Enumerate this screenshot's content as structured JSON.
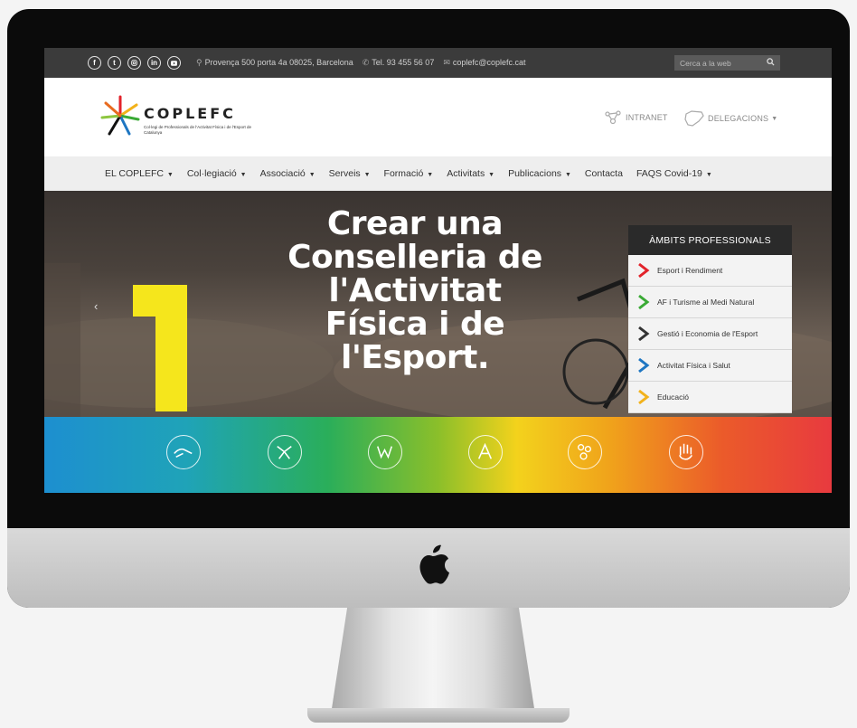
{
  "topbar": {
    "social": [
      "f",
      "t",
      "ig",
      "in",
      "yt"
    ],
    "address": "Provença 500 porta 4a 08025, Barcelona",
    "phone": "Tel. 93 455 56 07",
    "email": "coplefc@coplefc.cat",
    "search_placeholder": "Cerca a la web"
  },
  "header": {
    "logo_word": "COPLEFC",
    "logo_subtitle": "Col·legi de Professionals de l'Activitat Física i de l'Esport de Catalunya",
    "intranet_label": "INTRANET",
    "delegacions_label": "DELEGACIONS"
  },
  "nav": {
    "items": [
      {
        "label": "EL COPLEFC",
        "dropdown": true
      },
      {
        "label": "Col·legiació",
        "dropdown": true
      },
      {
        "label": "Associació",
        "dropdown": true
      },
      {
        "label": "Serveis",
        "dropdown": true
      },
      {
        "label": "Formació",
        "dropdown": true
      },
      {
        "label": "Activitats",
        "dropdown": true
      },
      {
        "label": "Publicacions",
        "dropdown": true
      },
      {
        "label": "Contacta",
        "dropdown": false
      },
      {
        "label": "FAQS Covid-19",
        "dropdown": true
      }
    ]
  },
  "hero": {
    "lines": [
      "Crear una",
      "Conselleria de",
      "l'Activitat",
      "Física i de",
      "l'Esport."
    ],
    "big_number": "1"
  },
  "ambits": {
    "title": "ÀMBITS PROFESSIONALS",
    "items": [
      {
        "label": "Esport i Rendiment",
        "color": "#e2232b"
      },
      {
        "label": "AF i Turisme al Medi Natural",
        "color": "#3aaa35"
      },
      {
        "label": "Gestió i Economia de l'Esport",
        "color": "#333333"
      },
      {
        "label": "Activitat Física i Salut",
        "color": "#1e76c2"
      },
      {
        "label": "Educació",
        "color": "#f2b21b"
      }
    ]
  },
  "colors": {
    "hero_number": "#f5e61c"
  }
}
